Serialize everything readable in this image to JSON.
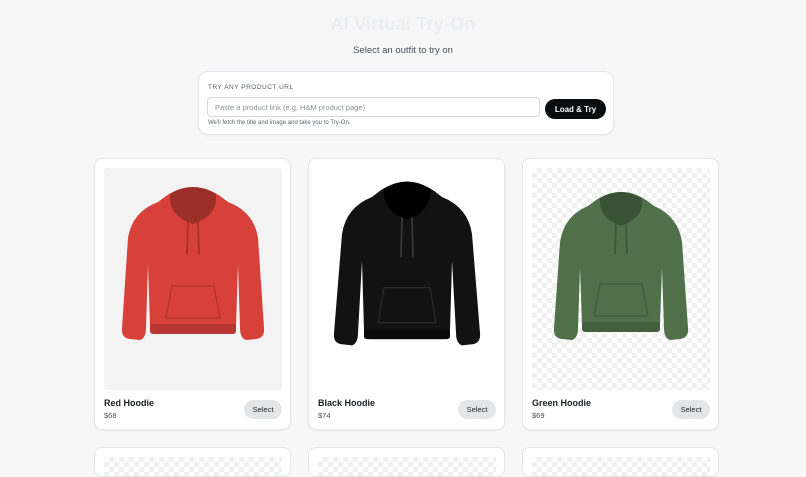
{
  "header": {
    "title": "AI Virtual Try-On",
    "subtitle": "Select an outfit to try on"
  },
  "url_tryon": {
    "label": "TRY ANY PRODUCT URL",
    "input_value": "",
    "placeholder": "Paste a product link (e.g. H&M product page)",
    "button_label": "Load & Try",
    "hint": "We'll fetch the title and image and take you to Try-On."
  },
  "products": [
    {
      "name": "Red Hoodie",
      "price": "$68",
      "select_label": "Select",
      "color": "#d8403a",
      "image_icon": "red-hoodie-image"
    },
    {
      "name": "Black Hoodie",
      "price": "$74",
      "select_label": "Select",
      "color": "#121212",
      "image_icon": "black-hoodie-image"
    },
    {
      "name": "Green Hoodie",
      "price": "$69",
      "select_label": "Select",
      "color": "#4f7048",
      "image_icon": "green-hoodie-image"
    }
  ]
}
